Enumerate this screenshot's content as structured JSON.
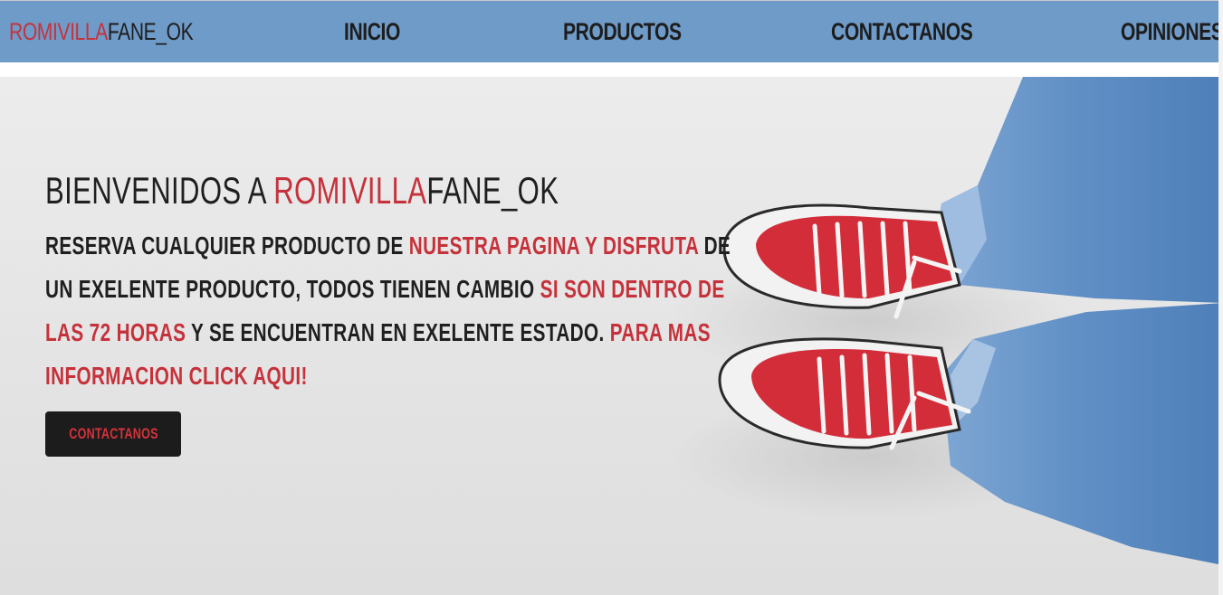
{
  "nav": {
    "logo_red": "ROMIVILLA",
    "logo_dark": "FANE_OK",
    "items": [
      {
        "label": "INICIO"
      },
      {
        "label": "PRODUCTOS"
      },
      {
        "label": "CONTACTANOS"
      },
      {
        "label": "OPINIONES"
      }
    ],
    "background": "#6f9bc8"
  },
  "hero": {
    "headline_prefix": "BIENVENIDOS A ",
    "headline_red": "ROMIVILLA",
    "headline_dark": "FANE_OK",
    "copy": [
      {
        "text": "RESERVA CUALQUIER PRODUCTO DE ",
        "accent": false
      },
      {
        "text": "NUESTRA PAGINA Y DISFRUTA",
        "accent": true
      },
      {
        "text": " DE UN EXELENTE PRODUCTO, TODOS TIENEN CAMBIO ",
        "accent": false
      },
      {
        "text": "SI SON DENTRO DE LAS 72 HORAS",
        "accent": true
      },
      {
        "text": " Y SE ENCUENTRAN EN EXELENTE ESTADO. ",
        "accent": false
      },
      {
        "text": "PARA MAS INFORMACION CLICK AQUI!",
        "accent": true
      }
    ],
    "cta_label": "CONTACTANOS",
    "image": "red-sneakers-and-jeans-photo"
  },
  "colors": {
    "accent": "#c6323b",
    "text": "#1f1f1f",
    "button": "#1c1c1c"
  }
}
